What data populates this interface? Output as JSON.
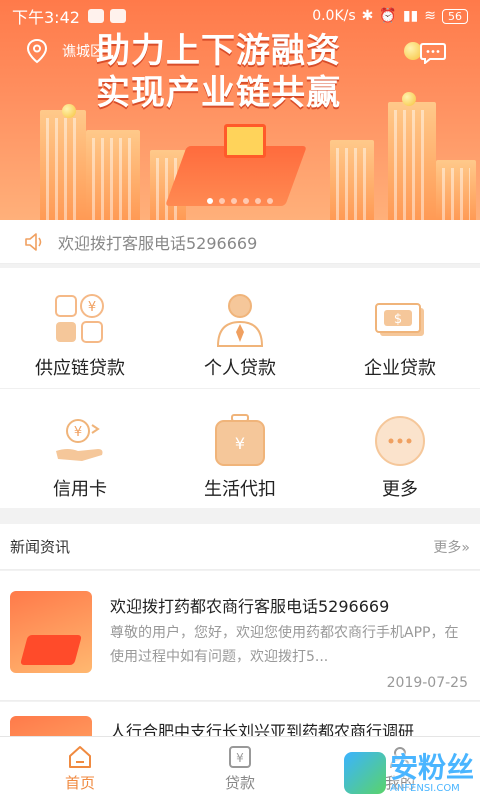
{
  "status_bar": {
    "time": "下午3:42",
    "network": "0.0K/s",
    "battery": "56"
  },
  "header": {
    "location": "谯城区",
    "headline_line1": "助力上下游融资",
    "headline_line2": "实现产业链共赢"
  },
  "banner": {
    "slides": 6,
    "active_slide": 0
  },
  "notice": {
    "text": "欢迎拨打客服电话5296669"
  },
  "services": [
    {
      "label": "供应链贷款",
      "icon": "supply-chain-loan-icon"
    },
    {
      "label": "个人贷款",
      "icon": "personal-loan-icon"
    },
    {
      "label": "企业贷款",
      "icon": "enterprise-loan-icon"
    },
    {
      "label": "信用卡",
      "icon": "credit-card-icon"
    },
    {
      "label": "生活代扣",
      "icon": "life-payment-icon"
    },
    {
      "label": "更多",
      "icon": "more-icon"
    }
  ],
  "news": {
    "section_title": "新闻资讯",
    "more_label": "更多»",
    "items": [
      {
        "title": "欢迎拨打药都农商行客服电话5296669",
        "desc": "尊敬的用户，您好，欢迎您使用药都农商行手机APP，在使用过程中如有问题，欢迎拨打5...",
        "date": "2019-07-25"
      },
      {
        "title": "人行合肥中支行长刘兴亚到药都农商行调研"
      }
    ]
  },
  "bottom_nav": [
    {
      "label": "首页",
      "icon": "home-icon",
      "active": true
    },
    {
      "label": "贷款",
      "icon": "loan-icon",
      "active": false
    },
    {
      "label": "我的",
      "icon": "profile-icon",
      "active": false
    }
  ],
  "watermark": {
    "text": "安粉丝",
    "sub": "ANFENSI.COM"
  },
  "colors": {
    "accent": "#f08a40",
    "banner": "#ff7a4a",
    "icon_fill": "#f5c79a"
  }
}
